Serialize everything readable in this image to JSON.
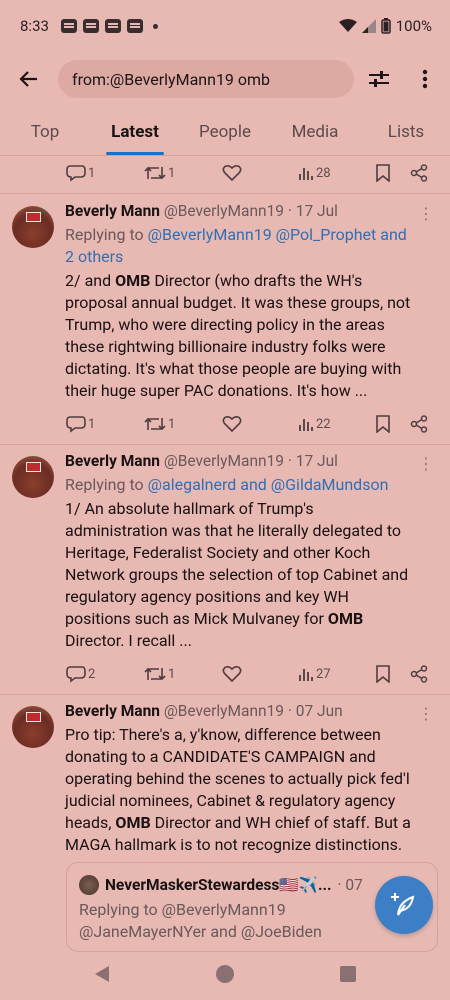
{
  "status_bar": {
    "time": "8:33",
    "battery": "100%"
  },
  "search": {
    "query": "from:@BeverlyMann19 omb"
  },
  "tabs": [
    "Top",
    "Latest",
    "People",
    "Media",
    "Lists"
  ],
  "top_actions": {
    "replies": "1",
    "reposts": "1",
    "views": "28"
  },
  "tweets": [
    {
      "name": "Beverly Mann",
      "handle": "@BeverlyMann19 · 17 Jul",
      "replying_prefix": "Replying to ",
      "replying_links": "@BeverlyMann19 @Pol_Prophet and",
      "replying_links_2": "2 others",
      "lines": [
        [
          "2/ and ",
          "OMB",
          " Director (who drafts the WH's"
        ],
        [
          "proposal annual budget. It was these groups, not"
        ],
        [
          "Trump, who were directing policy in the areas"
        ],
        [
          "these rightwing billionaire industry folks were"
        ],
        [
          "dictating. It's what those people are buying with"
        ],
        [
          "their huge super PAC donations. It's how ..."
        ]
      ],
      "replies": "1",
      "reposts": "1",
      "views": "22"
    },
    {
      "name": "Beverly Mann",
      "handle": "@BeverlyMann19 · 17 Jul",
      "replying_prefix": "Replying to ",
      "replying_links": "@alegalnerd and @GildaMundson",
      "lines": [
        [
          "1/ An absolute hallmark of Trump's"
        ],
        [
          "administration was that he literally delegated to"
        ],
        [
          "Heritage, Federalist Society and other Koch"
        ],
        [
          "Network groups the selection of top Cabinet and"
        ],
        [
          "regulatory agency positions and key WH"
        ],
        [
          "positions such as Mick Mulvaney for ",
          "OMB"
        ],
        [
          "Director. I recall ..."
        ]
      ],
      "replies": "2",
      "reposts": "1",
      "views": "27"
    },
    {
      "name": "Beverly Mann",
      "handle": "@BeverlyMann19 · 07 Jun",
      "lines": [
        [
          "Pro tip: There's a, y'know, difference between"
        ],
        [
          "donating to a CANDIDATE'S CAMPAIGN and"
        ],
        [
          "operating behind the scenes to actually pick fed'l"
        ],
        [
          "judicial nominees, Cabinet & regulatory agency"
        ],
        [
          "heads, ",
          "OMB",
          " Director and WH chief of staff. But a"
        ],
        [
          "MAGA hallmark is to not recognize distinctions."
        ]
      ]
    }
  ],
  "quote": {
    "name": "NeverMaskerStewardess🇺🇸✈️...",
    "handle": "· 07",
    "reply_line_1": "Replying to @BeverlyMann19",
    "reply_line_2": "@JaneMayerNYer and @JoeBiden"
  },
  "colors": {
    "background": "#e8b9b3",
    "accent": "#1d6fbf",
    "link": "#2f6fb4",
    "fab": "#3c7fc6"
  },
  "icons": {
    "back": "arrow-left-icon",
    "filter": "sliders-icon",
    "overflow": "more-vertical-icon",
    "reply": "comment-icon",
    "repost": "repost-icon",
    "like": "heart-icon",
    "views": "bar-chart-icon",
    "bookmark": "bookmark-icon",
    "share": "share-icon",
    "compose": "feather-plus-icon"
  }
}
